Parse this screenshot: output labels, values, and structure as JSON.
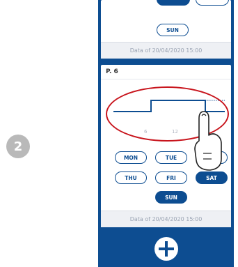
{
  "step": {
    "number": "2"
  },
  "top_card": {
    "days_visible": [
      "SUN"
    ],
    "footer": "Data of 20/04/2020 15:00"
  },
  "program_card": {
    "title": "P. 6",
    "hour_ticks": [
      "6",
      "12"
    ],
    "days_row1": [
      "MON",
      "TUE",
      ""
    ],
    "days_row2": [
      "THU",
      "FRI",
      "SAT"
    ],
    "days_row3": [
      "SUN"
    ],
    "footer": "Data of 20/04/2020 15:00"
  },
  "add_button": {
    "icon": "plus-icon"
  },
  "colors": {
    "primary": "#0d4d91",
    "highlight": "#c8141c",
    "step_badge": "#b9b9b9"
  }
}
